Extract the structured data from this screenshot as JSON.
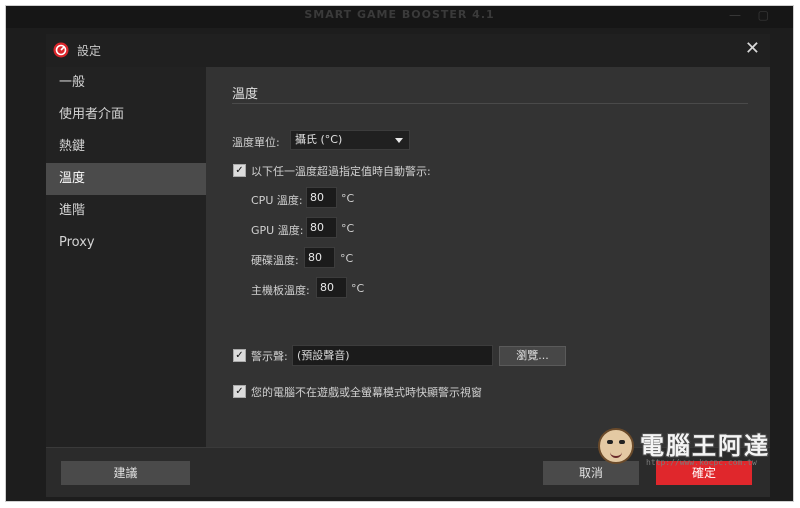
{
  "background_app": {
    "title": "SMART GAME BOOSTER 4.1",
    "minimize_glyph": "—",
    "maximize_glyph": "▢"
  },
  "dialog": {
    "title": "設定",
    "close_glyph": "✕",
    "logo_icon": "game-booster-logo-icon"
  },
  "sidebar": {
    "items": [
      {
        "label": "一般"
      },
      {
        "label": "使用者介面"
      },
      {
        "label": "熱鍵"
      },
      {
        "label": "溫度",
        "active": true
      },
      {
        "label": "進階"
      },
      {
        "label": "Proxy"
      }
    ]
  },
  "temperature": {
    "section_title": "溫度",
    "unit_label": "溫度單位:",
    "unit_value": "攝氏 (°C)",
    "alert_checkbox_label": "以下任一溫度超過指定值時自動警示:",
    "alert_checked": true,
    "rows": [
      {
        "label": "CPU 溫度:",
        "value": "80",
        "unit": "°C"
      },
      {
        "label": "GPU 溫度:",
        "value": "80",
        "unit": "°C"
      },
      {
        "label": "硬碟溫度:",
        "value": "80",
        "unit": "°C"
      },
      {
        "label": "主機板溫度:",
        "value": "80",
        "unit": "°C"
      }
    ],
    "sound_checkbox_label": "警示聲:",
    "sound_checked": true,
    "sound_value": "(預設聲音)",
    "browse_label": "瀏覽...",
    "no_popup_label": "您的電腦不在遊戲或全螢幕模式時快顯警示視窗",
    "no_popup_checked": true
  },
  "footer": {
    "suggest_label": "建議",
    "cancel_label": "取消",
    "ok_label": "確定"
  },
  "watermark": {
    "text": "電腦王阿達",
    "url": "http://www.kocpc.com.tw"
  },
  "colors": {
    "accent": "#e0272c",
    "dialog_bg": "#2b2b2b",
    "sidebar_active": "#4b4b4b"
  }
}
